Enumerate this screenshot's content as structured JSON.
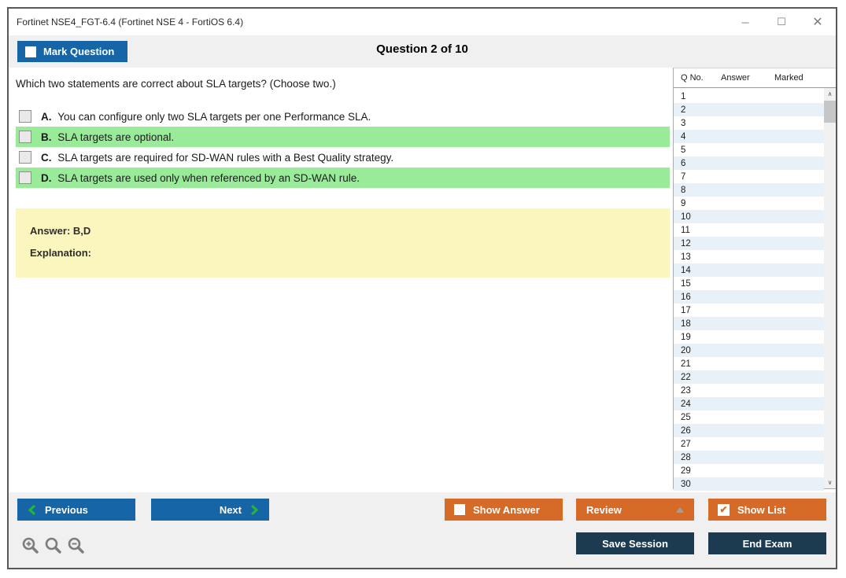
{
  "window": {
    "title": "Fortinet NSE4_FGT-6.4 (Fortinet NSE 4 - FortiOS 6.4)",
    "controls": {
      "minimize": "─",
      "maximize": "☐",
      "close": "✕"
    }
  },
  "header": {
    "mark_question_label": "Mark Question",
    "question_counter": "Question 2 of 10"
  },
  "question": {
    "text": "Which two statements are correct about SLA targets? (Choose two.)",
    "options": [
      {
        "letter": "A.",
        "text": "You can configure only two SLA targets per one Performance SLA.",
        "highlighted": false,
        "checked": false
      },
      {
        "letter": "B.",
        "text": "SLA targets are optional.",
        "highlighted": true,
        "checked": false
      },
      {
        "letter": "C.",
        "text": "SLA targets are required for SD-WAN rules with a Best Quality strategy.",
        "highlighted": false,
        "checked": false
      },
      {
        "letter": "D.",
        "text": "SLA targets are used only when referenced by an SD-WAN rule.",
        "highlighted": true,
        "checked": false
      }
    ],
    "answer_label": "Answer: B,D",
    "explanation_label": "Explanation:"
  },
  "question_list": {
    "columns": [
      "Q No.",
      "Answer",
      "Marked"
    ],
    "scroll_icons": {
      "up": "∧",
      "down": "∨"
    },
    "rows": [
      {
        "q": "1",
        "answer": "",
        "marked": ""
      },
      {
        "q": "2",
        "answer": "",
        "marked": ""
      },
      {
        "q": "3",
        "answer": "",
        "marked": ""
      },
      {
        "q": "4",
        "answer": "",
        "marked": ""
      },
      {
        "q": "5",
        "answer": "",
        "marked": ""
      },
      {
        "q": "6",
        "answer": "",
        "marked": ""
      },
      {
        "q": "7",
        "answer": "",
        "marked": ""
      },
      {
        "q": "8",
        "answer": "",
        "marked": ""
      },
      {
        "q": "9",
        "answer": "",
        "marked": ""
      },
      {
        "q": "10",
        "answer": "",
        "marked": ""
      },
      {
        "q": "11",
        "answer": "",
        "marked": ""
      },
      {
        "q": "12",
        "answer": "",
        "marked": ""
      },
      {
        "q": "13",
        "answer": "",
        "marked": ""
      },
      {
        "q": "14",
        "answer": "",
        "marked": ""
      },
      {
        "q": "15",
        "answer": "",
        "marked": ""
      },
      {
        "q": "16",
        "answer": "",
        "marked": ""
      },
      {
        "q": "17",
        "answer": "",
        "marked": ""
      },
      {
        "q": "18",
        "answer": "",
        "marked": ""
      },
      {
        "q": "19",
        "answer": "",
        "marked": ""
      },
      {
        "q": "20",
        "answer": "",
        "marked": ""
      },
      {
        "q": "21",
        "answer": "",
        "marked": ""
      },
      {
        "q": "22",
        "answer": "",
        "marked": ""
      },
      {
        "q": "23",
        "answer": "",
        "marked": ""
      },
      {
        "q": "24",
        "answer": "",
        "marked": ""
      },
      {
        "q": "25",
        "answer": "",
        "marked": ""
      },
      {
        "q": "26",
        "answer": "",
        "marked": ""
      },
      {
        "q": "27",
        "answer": "",
        "marked": ""
      },
      {
        "q": "28",
        "answer": "",
        "marked": ""
      },
      {
        "q": "29",
        "answer": "",
        "marked": ""
      },
      {
        "q": "30",
        "answer": "",
        "marked": ""
      }
    ]
  },
  "footer": {
    "previous_label": "Previous",
    "next_label": "Next",
    "show_answer_label": "Show Answer",
    "review_label": "Review",
    "show_list_label": "Show List",
    "save_session_label": "Save Session",
    "end_exam_label": "End Exam",
    "check_glyph": "✔"
  },
  "colors": {
    "blue": "#1565A7",
    "orange": "#D66B27",
    "navy": "#1C3A50",
    "green": "#99EB99",
    "yellow": "#FBF5BE",
    "altrow": "#E9F1F8"
  }
}
